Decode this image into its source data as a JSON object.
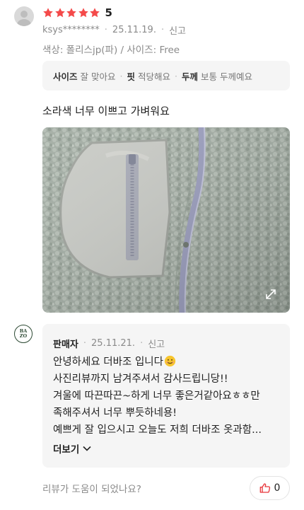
{
  "review": {
    "rating_value": "5",
    "star_count": 5,
    "star_color": "#f44a4a",
    "author": "ksys********",
    "date": "25.11.19.",
    "report_label": "신고",
    "options": "색상: 폴리스jp(파) / 사이즈: Free",
    "attributes": [
      {
        "key": "사이즈",
        "value": "잘 맞아요"
      },
      {
        "key": "핏",
        "value": "적당해요"
      },
      {
        "key": "두께",
        "value": "보통 두께예요"
      }
    ],
    "content": "소라색 너무 이쁘고 가벼워요"
  },
  "seller_reply": {
    "logo_text": [
      "BA",
      "ZO"
    ],
    "name": "판매자",
    "date": "25.11.21.",
    "report_label": "신고",
    "lines": [
      "안녕하세요 더바조 입니다",
      "사진리뷰까지 남겨주셔서 감사드립니당!!",
      "겨울에 따끈따끈~하게 너무 좋은거같아요ㅎㅎ만",
      "족해주셔서 너무 뿌듯하네용!",
      "예쁘게 잘 입으시고 오늘도 저희 더바조 옷과함..."
    ],
    "more_label": "더보기"
  },
  "footer": {
    "helpful_question": "리뷰가 도움이 되었나요?",
    "like_count": "0",
    "like_color": "#e8363b"
  }
}
